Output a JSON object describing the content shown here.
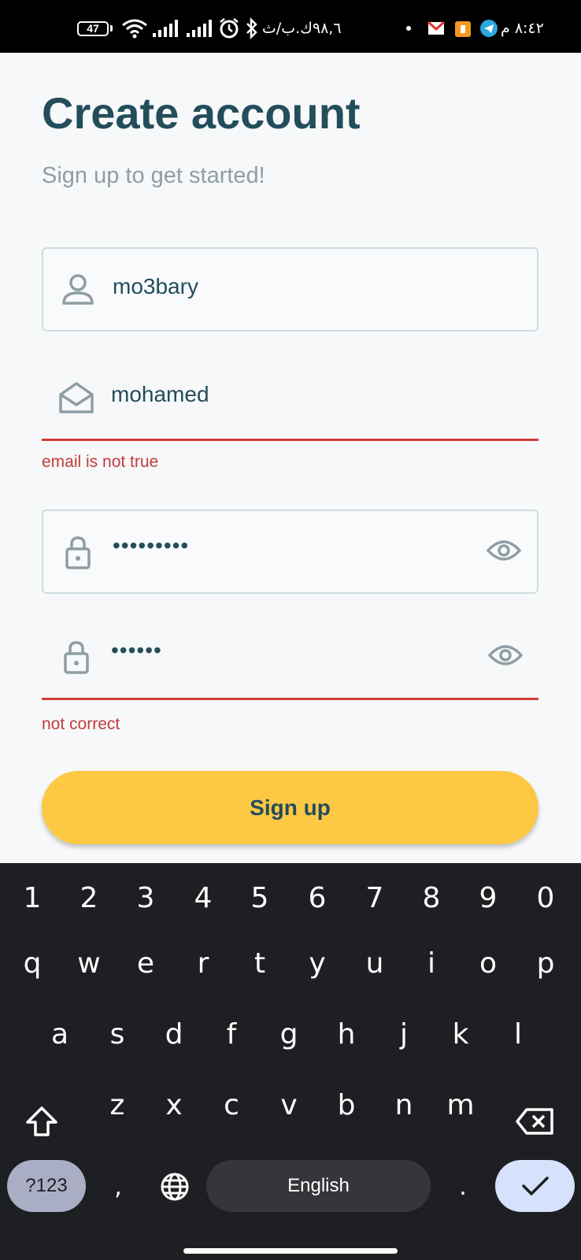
{
  "status_bar": {
    "battery": "47",
    "data_speed": "٩٨,٦ك.ب/ث",
    "time": "٨:٤٢ م",
    "icons": [
      "wifi-icon",
      "signal-icon",
      "signal-icon",
      "alarm-icon",
      "bluetooth-icon",
      "dot-icon",
      "gmail-icon",
      "notification-app-icon",
      "telegram-icon"
    ]
  },
  "form": {
    "title": "Create account",
    "subtitle": "Sign up to get started!",
    "username": {
      "value": "mo3bary",
      "icon": "person-icon"
    },
    "email": {
      "value": "mohamed",
      "icon": "envelope-icon",
      "error": "email is not true"
    },
    "password": {
      "value": "•••••••••",
      "icon": "lock-icon",
      "toggle_icon": "eye-icon"
    },
    "confirm_password": {
      "value": "••••••",
      "icon": "lock-icon",
      "toggle_icon": "eye-icon",
      "error": "not correct"
    },
    "submit_label": "Sign up"
  },
  "colors": {
    "primary": "#234d5b",
    "accent": "#fdc843",
    "error": "#c43b3b",
    "border": "#cfdcdf",
    "keyboard_bg": "#1e1f22"
  },
  "keyboard": {
    "row_numbers": [
      "1",
      "2",
      "3",
      "4",
      "5",
      "6",
      "7",
      "8",
      "9",
      "0"
    ],
    "row_top": [
      "q",
      "w",
      "e",
      "r",
      "t",
      "y",
      "u",
      "i",
      "o",
      "p"
    ],
    "row_middle": [
      "a",
      "s",
      "d",
      "f",
      "g",
      "h",
      "j",
      "k",
      "l"
    ],
    "row_bottom": [
      "z",
      "x",
      "c",
      "v",
      "b",
      "n",
      "m"
    ],
    "symbols_label": "?123",
    "comma": ",",
    "space_label": "English",
    "period": "."
  }
}
